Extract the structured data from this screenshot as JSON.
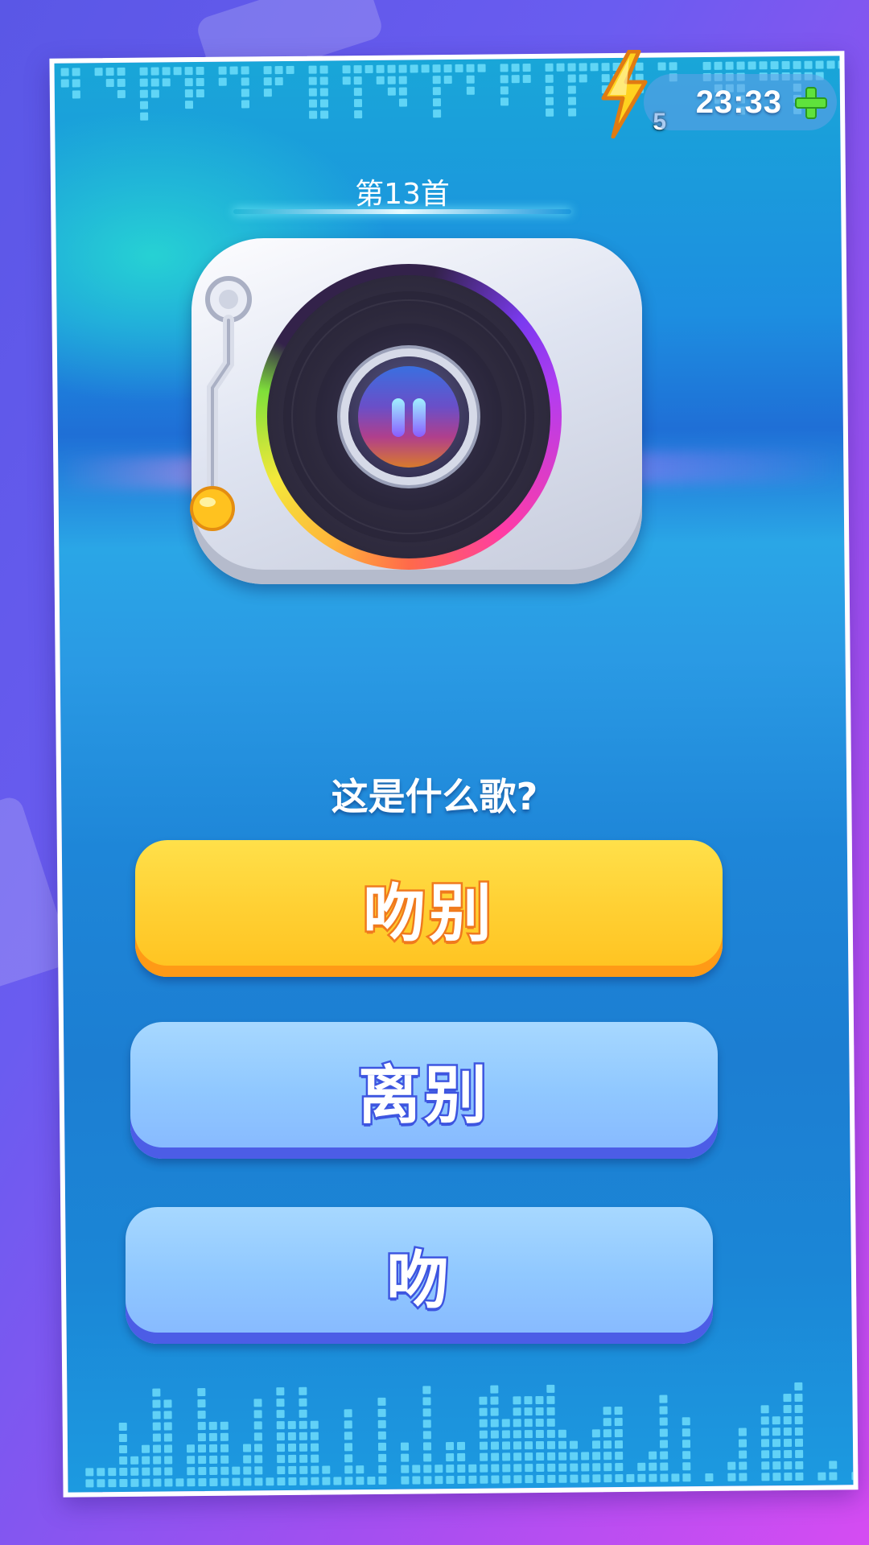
{
  "hud": {
    "energy_count": "5",
    "timer": "23:33"
  },
  "song": {
    "number_label": "第13首"
  },
  "question": "这是什么歌?",
  "answers": [
    "吻别",
    "离别",
    "吻"
  ]
}
